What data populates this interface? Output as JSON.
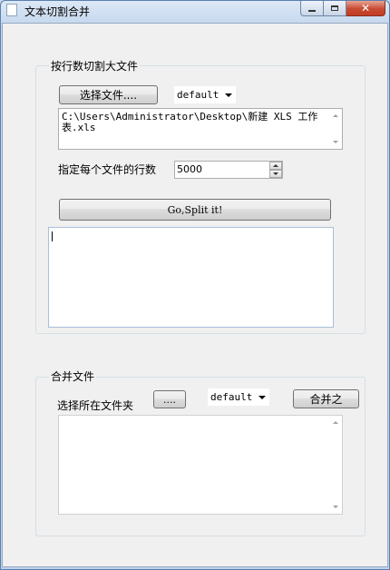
{
  "window": {
    "title": "文本切割合并",
    "close_glyph": "✕"
  },
  "split": {
    "group_title": "按行数切割大文件",
    "choose_file_label": "选择文件....",
    "encoding_value": "default",
    "file_path": "C:\\Users\\Administrator\\Desktop\\新建 XLS 工作表.xls",
    "lines_label": "指定每个文件的行数",
    "lines_value": "5000",
    "go_label": "Go,Split it!",
    "log_text": ""
  },
  "merge": {
    "group_title": "合并文件",
    "folder_label": "选择所在文件夹",
    "browse_label": "....",
    "encoding_value": "default",
    "merge_label": "合并之",
    "file_list_text": ""
  }
}
